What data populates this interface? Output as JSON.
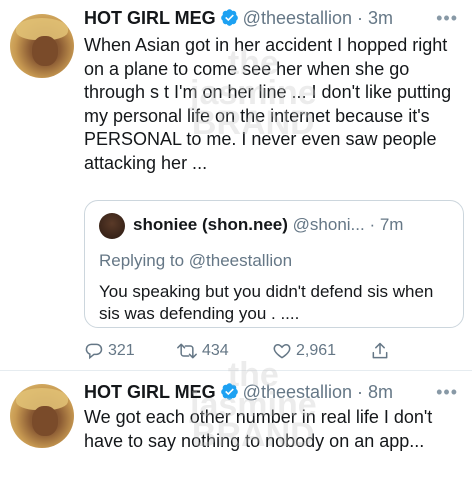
{
  "tweets": [
    {
      "name": "HOT GIRL MEG",
      "handle": "@theestallion",
      "time": "3m",
      "text": "When Asian got in her accident I hopped right on a plane to come see her when she go through s  t I'm on her line ... I don't like putting my personal life on the internet because it's PERSONAL to me. I never even saw people attacking her ...",
      "quote": {
        "name": "shoniee (shon.nee)",
        "handle": "@shoni...",
        "time": "7m",
        "replying": "Replying to @theestallion",
        "text": "You speaking but you didn't defend sis when sis was defending you . ...."
      },
      "actions": {
        "replies": "321",
        "retweets": "434",
        "likes": "2,961"
      }
    },
    {
      "name": "HOT GIRL MEG",
      "handle": "@theestallion",
      "time": "8m",
      "text": "We got each other number in real life I don't have to say nothing to nobody on an app..."
    }
  ],
  "icons": [
    "verified-badge-icon",
    "more-icon",
    "reply-icon",
    "retweet-icon",
    "like-icon",
    "share-icon"
  ],
  "colors": {
    "verified": "#1da1f2",
    "muted": "#657786",
    "border": "#ccd6dd"
  },
  "watermark": {
    "line1": "the",
    "line2": "jasmine",
    "line3": "BRAND"
  }
}
